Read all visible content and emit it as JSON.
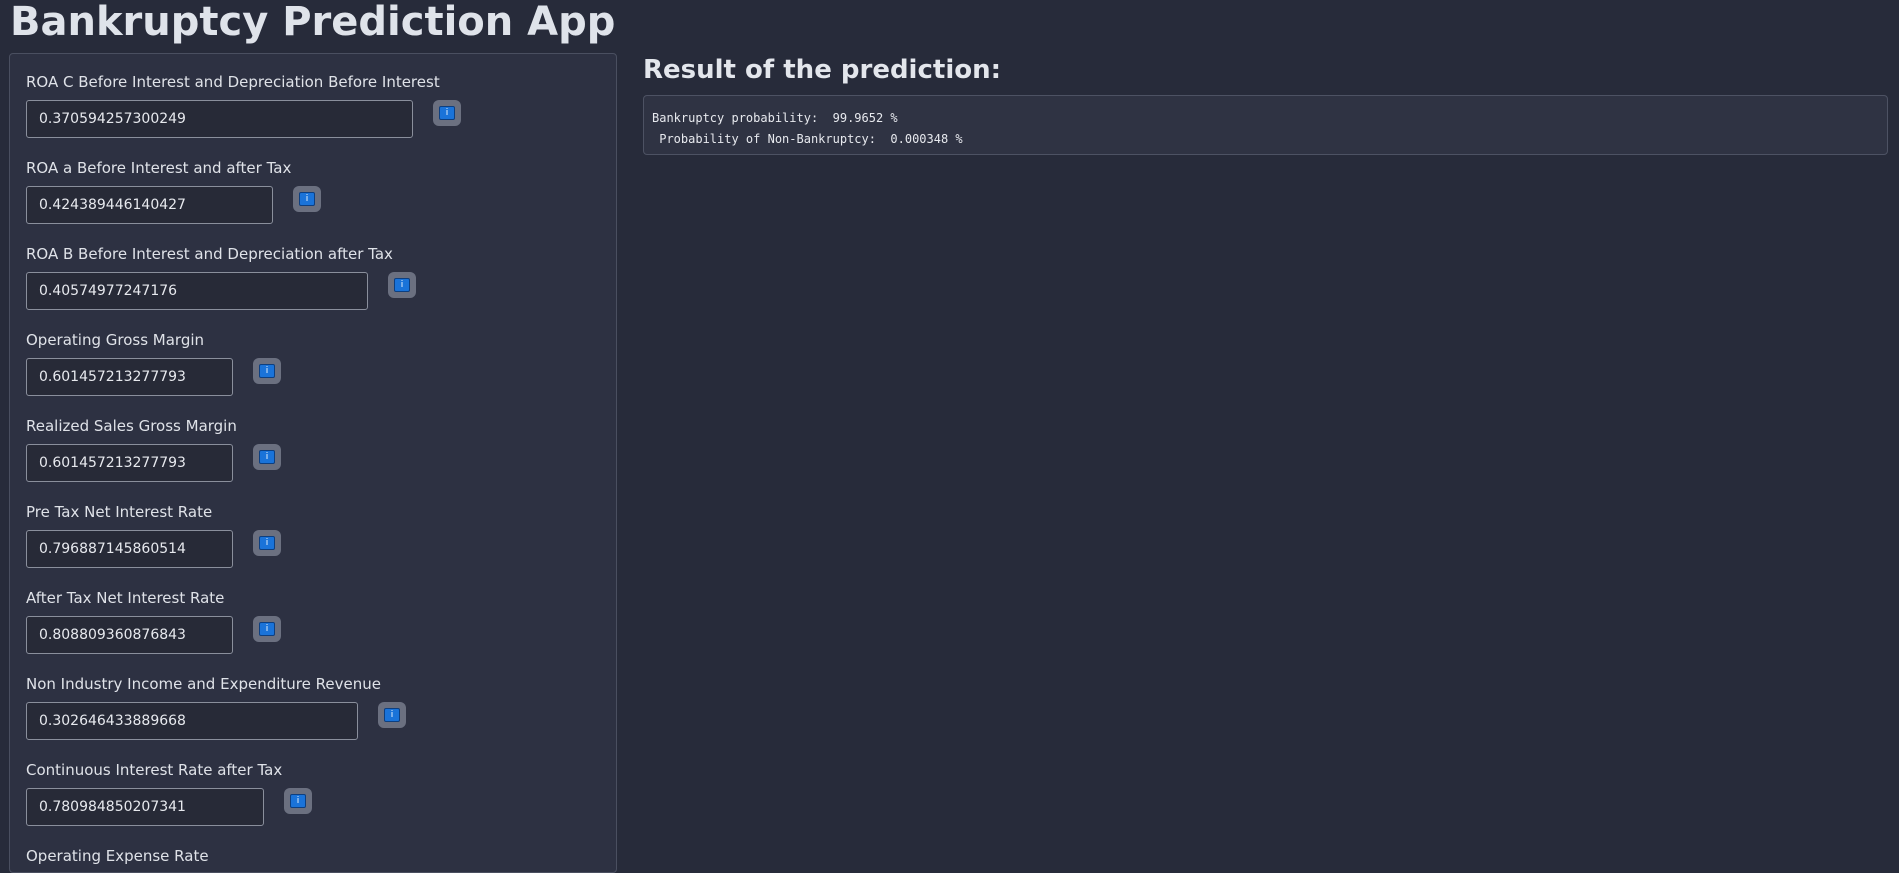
{
  "app": {
    "title": "Bankruptcy Prediction App"
  },
  "sidebar": {
    "fields": [
      {
        "label": "ROA C Before Interest and Depreciation Before Interest",
        "value": "0.370594257300249",
        "info_icon": "info-icon"
      },
      {
        "label": "ROA a Before Interest and after Tax",
        "value": "0.424389446140427",
        "info_icon": "info-icon"
      },
      {
        "label": "ROA B Before Interest and Depreciation after Tax",
        "value": "0.40574977247176",
        "info_icon": "info-icon"
      },
      {
        "label": "Operating Gross Margin",
        "value": "0.601457213277793",
        "info_icon": "info-icon"
      },
      {
        "label": "Realized Sales Gross Margin",
        "value": "0.601457213277793",
        "info_icon": "info-icon"
      },
      {
        "label": "Pre Tax Net Interest Rate",
        "value": "0.796887145860514",
        "info_icon": "info-icon"
      },
      {
        "label": "After Tax Net Interest Rate",
        "value": "0.808809360876843",
        "info_icon": "info-icon"
      },
      {
        "label": "Non Industry Income and Expenditure Revenue",
        "value": "0.302646433889668",
        "info_icon": "info-icon"
      },
      {
        "label": "Continuous Interest Rate after Tax",
        "value": "0.780984850207341",
        "info_icon": "info-icon"
      },
      {
        "label": "Operating Expense Rate",
        "value": "",
        "info_icon": "info-icon"
      }
    ]
  },
  "result": {
    "heading": "Result of the prediction:",
    "output": "Bankruptcy probability:  99.9652 %\n Probability of Non-Bankruptcy:  0.000348 %"
  },
  "colors": {
    "background": "#272b3a",
    "panel": "#2d3142",
    "info_icon_blue": "#1a73d9"
  }
}
